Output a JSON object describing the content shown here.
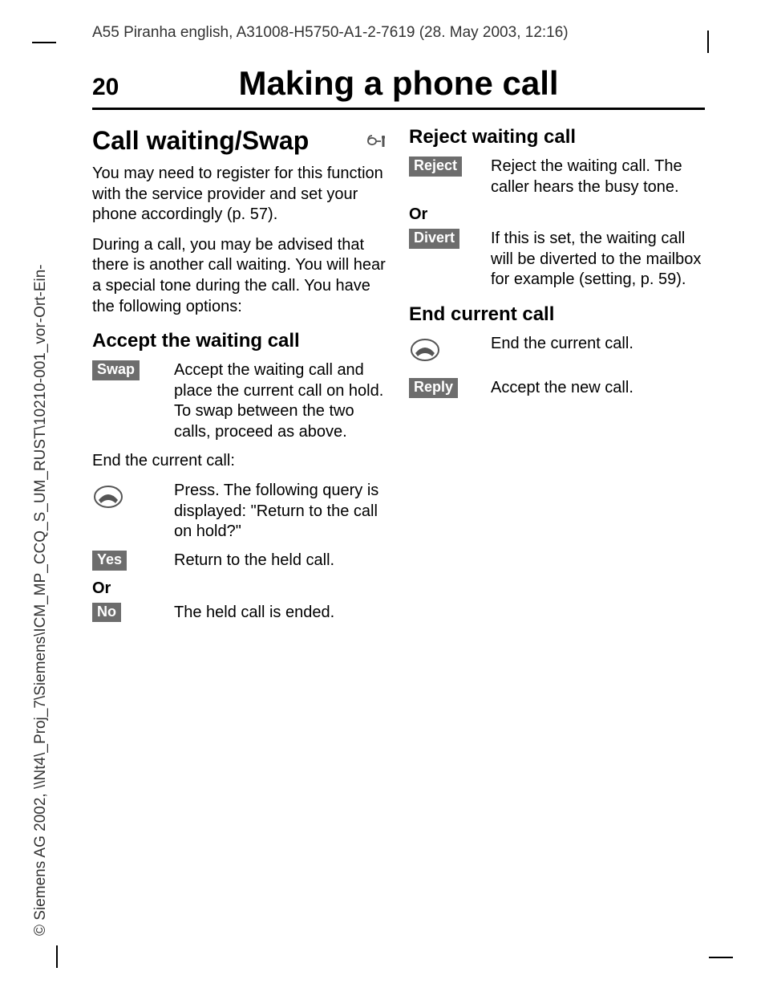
{
  "header": "A55 Piranha english, A31008-H5750-A1-2-7619 (28. May 2003, 12:16)",
  "sideCopyright": "© Siemens AG 2002, \\\\Nt4\\_Proj_7\\Siemens\\ICM_MP_CCQ_S_UM_RUST\\10210-001_vor-Ort-Ein-",
  "pageNum": "20",
  "pageTitle": "Making a phone call",
  "left": {
    "h1": "Call waiting/Swap",
    "p1": "You may need to register for this function with the service provider and set your phone accordingly (p. 57).",
    "p2": "During a call, you may be advised that there is another call waiting. You will hear a special tone during the call. You have the following options:",
    "h2a": "Accept the waiting call",
    "swapKey": "Swap",
    "swapDesc": "Accept the waiting call and place the current call on hold. To swap between the two calls, proceed as above.",
    "endLabel": "End the current call:",
    "pressDesc": "Press. The following query is displayed: \"Return to the call on hold?\"",
    "yesKey": "Yes",
    "yesDesc": "Return to the held call.",
    "or": "Or",
    "noKey": "No",
    "noDesc": "The held call is ended."
  },
  "right": {
    "h2a": "Reject waiting call",
    "rejectKey": "Reject",
    "rejectDesc": "Reject the waiting call. The caller hears the busy tone.",
    "or": "Or",
    "divertKey": "Divert",
    "divertDesc": "If this is set, the waiting call will be diverted to the mailbox for example (setting, p. 59).",
    "h2b": "End current call",
    "endDesc": "End the current call.",
    "replyKey": "Reply",
    "replyDesc": "Accept the new call."
  }
}
